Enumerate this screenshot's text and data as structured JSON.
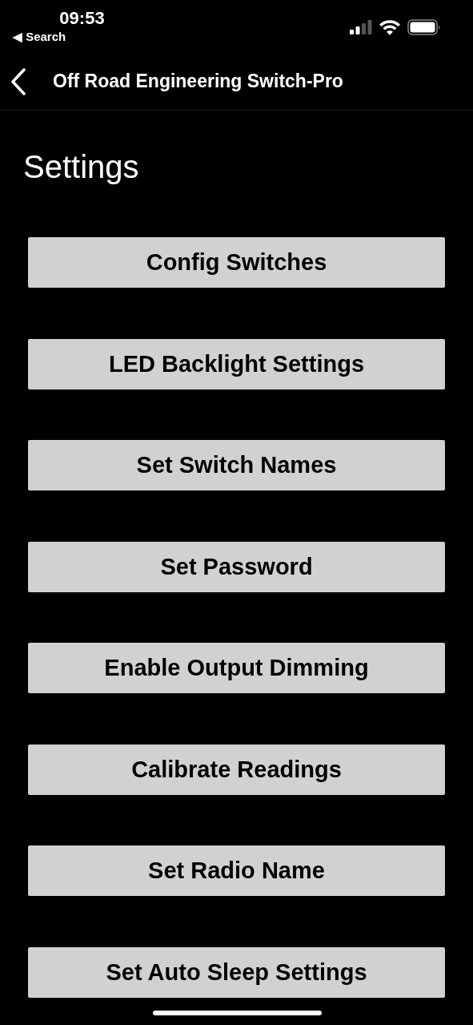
{
  "status_bar": {
    "time": "09:53",
    "back_label": "◀ Search"
  },
  "nav_bar": {
    "title": "Off Road Engineering Switch-Pro"
  },
  "page_title": "Settings",
  "buttons": [
    {
      "label": "Config Switches"
    },
    {
      "label": "LED Backlight Settings"
    },
    {
      "label": "Set Switch Names"
    },
    {
      "label": "Set Password"
    },
    {
      "label": "Enable Output Dimming"
    },
    {
      "label": "Calibrate Readings"
    },
    {
      "label": "Set Radio Name"
    },
    {
      "label": "Set Auto Sleep Settings"
    }
  ]
}
